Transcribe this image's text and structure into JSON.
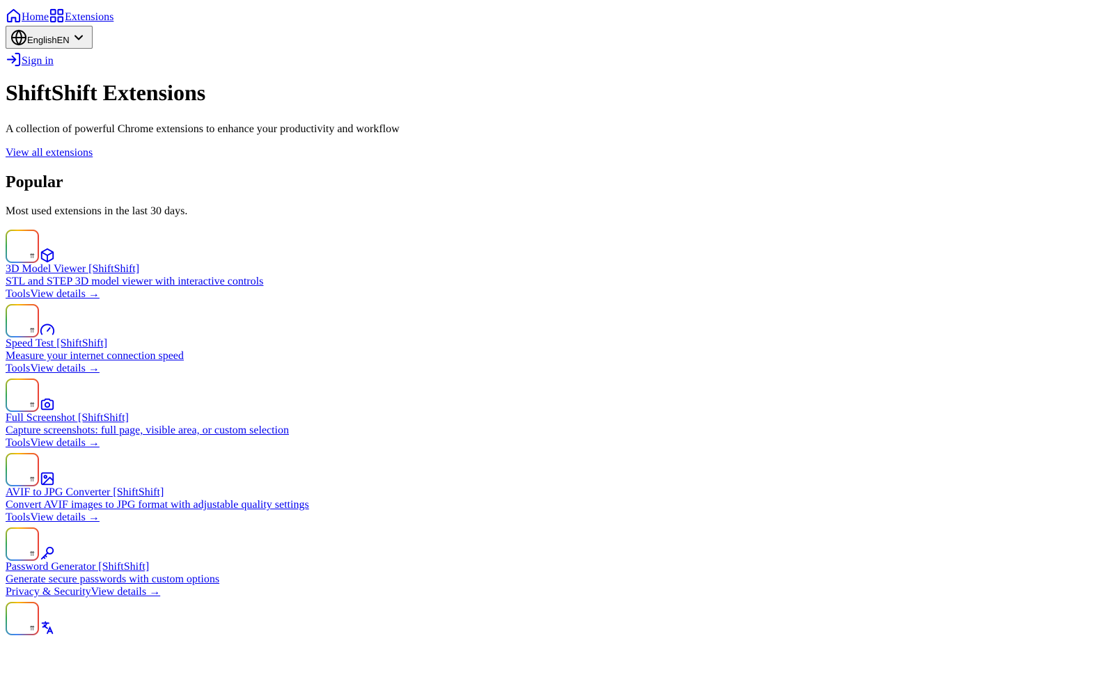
{
  "nav": {
    "home_label": "Home",
    "extensions_label": "Extensions"
  },
  "language": {
    "name": "English",
    "code": "EN"
  },
  "signin": {
    "label": "Sign in"
  },
  "hero": {
    "title": "ShiftShift Extensions",
    "subtitle": "A collection of powerful Chrome extensions to enhance your productivity and workflow",
    "view_all": "View all extensions"
  },
  "popular": {
    "heading": "Popular",
    "description": "Most used extensions in the last 30 days.",
    "items": [
      {
        "name": "3D Model Viewer [ShiftShift]",
        "description": "STL and STEP 3D model viewer with interactive controls",
        "category": "Tools",
        "details": "View details →",
        "icon": "cube-icon"
      },
      {
        "name": "Speed Test [ShiftShift]",
        "description": "Measure your internet connection speed",
        "category": "Tools",
        "details": "View details →",
        "icon": "gauge-icon"
      },
      {
        "name": "Full Screenshot [ShiftShift]",
        "description": "Capture screenshots: full page, visible area, or custom selection",
        "category": "Tools",
        "details": "View details →",
        "icon": "camera-icon"
      },
      {
        "name": "AVIF to JPG Converter [ShiftShift]",
        "description": "Convert AVIF images to JPG format with adjustable quality settings",
        "category": "Tools",
        "details": "View details →",
        "icon": "image-icon"
      },
      {
        "name": "Password Generator [ShiftShift]",
        "description": "Generate secure passwords with custom options",
        "category": "Privacy & Security",
        "details": "View details →",
        "icon": "key-icon"
      },
      {
        "icon": "translate-icon"
      }
    ]
  },
  "colors": {
    "link": "#0000ee",
    "icon_stroke": "#0000ee",
    "logo_gradient": [
      "#4285f4",
      "#34a853",
      "#fbbc05",
      "#ea4335"
    ]
  }
}
